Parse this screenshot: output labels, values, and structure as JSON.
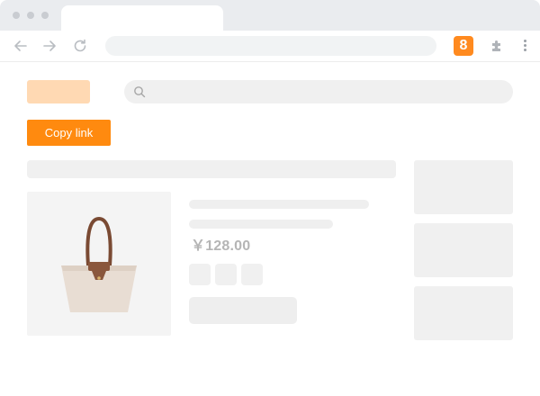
{
  "browser": {
    "extension_badge": "8",
    "icons": [
      "back-arrow-icon",
      "forward-arrow-icon",
      "reload-icon",
      "puzzle-extension-icon",
      "more-menu-icon"
    ]
  },
  "page": {
    "copy_button_label": "Copy link",
    "product": {
      "price": "￥128.00",
      "image": "tote-bag-image"
    },
    "colors": {
      "accent": "#ff8a0f",
      "logo_placeholder": "#ffd9b3",
      "badge": "#ff8a1f"
    }
  }
}
